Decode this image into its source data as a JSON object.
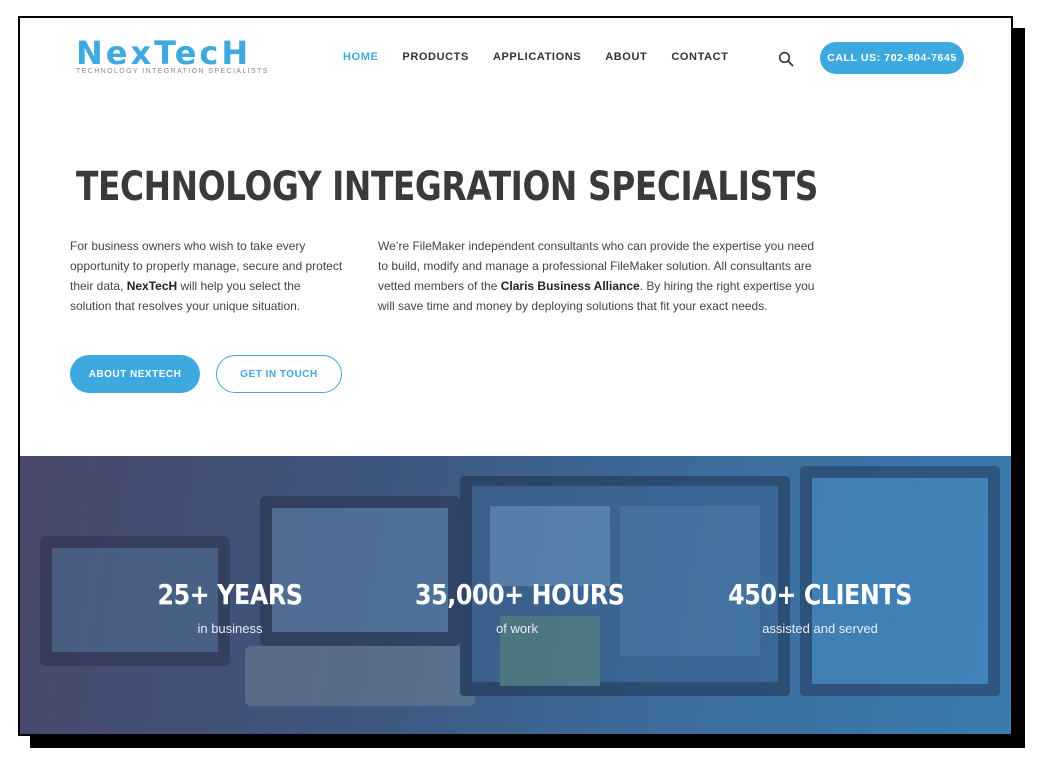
{
  "brand": {
    "logo_text": "NexTecH",
    "tagline": "TECHNOLOGY INTEGRATION SPECIALISTS"
  },
  "nav": {
    "items": [
      {
        "label": "HOME",
        "active": true
      },
      {
        "label": "PRODUCTS",
        "active": false
      },
      {
        "label": "APPLICATIONS",
        "active": false
      },
      {
        "label": "ABOUT",
        "active": false
      },
      {
        "label": "CONTACT",
        "active": false
      }
    ],
    "call_label": "CALL US: 702-804-7645"
  },
  "hero": {
    "headline": "TECHNOLOGY INTEGRATION SPECIALISTS",
    "left_pre": "For business owners who wish to take every opportunity to properly manage, secure and protect their data, ",
    "left_bold": "NexTecH",
    "left_post": " will help you select the solution that resolves your unique situation.",
    "right_pre": "We’re FileMaker independent consultants who can provide the expertise you need to build, modify and manage a professional FileMaker solution. All consultants are vetted members of the ",
    "right_bold": "Claris Business Alliance",
    "right_post": ". By hiring the right expertise you will save time and money by deploying solutions that fit your exact needs.",
    "btn_about": "ABOUT NEXTECH",
    "btn_touch": "GET IN TOUCH"
  },
  "stats": [
    {
      "value": "25+ YEARS",
      "label": "in business"
    },
    {
      "value": "35,000+ HOURS",
      "label": "of work"
    },
    {
      "value": "450+ CLIENTS",
      "label": "assisted and served"
    }
  ],
  "colors": {
    "accent": "#3ea9df",
    "heading": "#3a3a3a",
    "text": "#444444"
  },
  "icons": {
    "search": "search-icon"
  }
}
